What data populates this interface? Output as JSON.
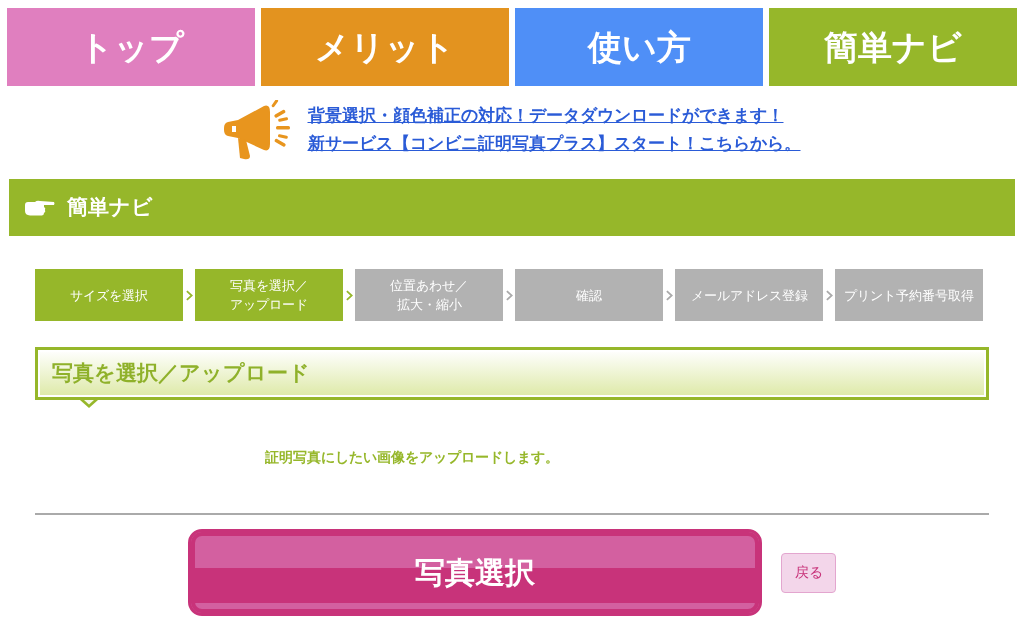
{
  "nav_tabs": [
    {
      "label": "トップ",
      "color": "#e07fbf"
    },
    {
      "label": "メリット",
      "color": "#e3931f"
    },
    {
      "label": "使い方",
      "color": "#4f8ff7"
    },
    {
      "label": "簡単ナビ",
      "color": "#96b72a"
    }
  ],
  "announcement": {
    "links": [
      "背景選択・顔色補正の対応！データダウンロードができます！",
      "新サービス【コンビニ証明写真プラス】スタート！こちらから。"
    ]
  },
  "section_header": {
    "title": "簡単ナビ"
  },
  "steps": [
    {
      "lines": [
        "サイズを選択"
      ],
      "active": true
    },
    {
      "lines": [
        "写真を選択／",
        "アップロード"
      ],
      "active": true
    },
    {
      "lines": [
        "位置あわせ／",
        "拡大・縮小"
      ],
      "active": false
    },
    {
      "lines": [
        "確認"
      ],
      "active": false
    },
    {
      "lines": [
        "メールアドレス登録"
      ],
      "active": false
    },
    {
      "lines": [
        "プリント予約番号取得"
      ],
      "active": false
    }
  ],
  "panel": {
    "heading": "写真を選択／アップロード",
    "text": "証明写真にしたい画像をアップロードします。"
  },
  "buttons": {
    "primary": "写真選択",
    "back": "戻る"
  }
}
